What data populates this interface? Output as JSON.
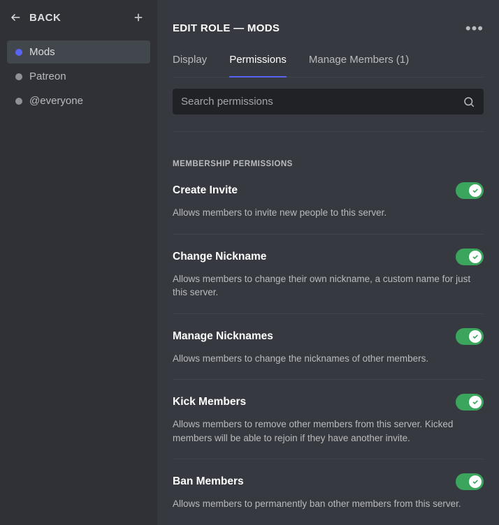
{
  "sidebar": {
    "back_label": "BACK",
    "items": [
      {
        "label": "Mods",
        "color": "#5865f2",
        "selected": true
      },
      {
        "label": "Patreon",
        "color": "#8e9297",
        "selected": false
      },
      {
        "label": "@everyone",
        "color": "#8e9297",
        "selected": false
      }
    ]
  },
  "header": {
    "title": "EDIT ROLE — MODS"
  },
  "tabs": [
    {
      "label": "Display",
      "active": false
    },
    {
      "label": "Permissions",
      "active": true
    },
    {
      "label": "Manage Members (1)",
      "active": false
    }
  ],
  "search": {
    "placeholder": "Search permissions",
    "value": ""
  },
  "section_header": "MEMBERSHIP PERMISSIONS",
  "permissions": [
    {
      "title": "Create Invite",
      "desc": "Allows members to invite new people to this server.",
      "enabled": true
    },
    {
      "title": "Change Nickname",
      "desc": "Allows members to change their own nickname, a custom name for just this server.",
      "enabled": true
    },
    {
      "title": "Manage Nicknames",
      "desc": "Allows members to change the nicknames of other members.",
      "enabled": true
    },
    {
      "title": "Kick Members",
      "desc": "Allows members to remove other members from this server. Kicked members will be able to rejoin if they have another invite.",
      "enabled": true
    },
    {
      "title": "Ban Members",
      "desc": "Allows members to permanently ban other members from this server.",
      "enabled": true
    }
  ],
  "colors": {
    "accent": "#5865f2",
    "toggle_on": "#3ba55d"
  }
}
